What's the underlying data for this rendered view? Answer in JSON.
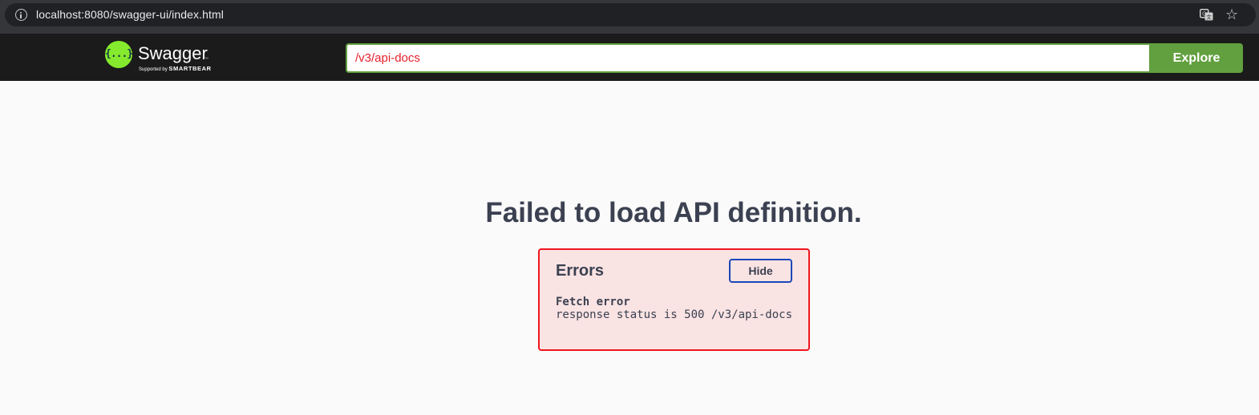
{
  "browser": {
    "url": "localhost:8080/swagger-ui/index.html",
    "icons": {
      "site_info": "info-circle-icon",
      "translate": "translate-icon",
      "bookmark": "star-icon"
    }
  },
  "topbar": {
    "logo": {
      "mark": "{...}",
      "name": "Swagger",
      "tm": "™",
      "supported_by": "Supported by",
      "brand": "SMARTBEAR"
    },
    "url_input_value": "/v3/api-docs",
    "explore_label": "Explore"
  },
  "main": {
    "title": "Failed to load API definition.",
    "errors": {
      "title": "Errors",
      "hide_label": "Hide",
      "error_heading": "Fetch error",
      "error_message": "response status is 500 /v3/api-docs"
    }
  },
  "colors": {
    "topbar_bg": "#1b1b1b",
    "accent_green": "#62a03f",
    "logo_green": "#85ea2d",
    "error_border": "#f0141e",
    "error_bg": "#fae3e3",
    "text": "#3b4151",
    "url_text": "#e8202a",
    "hide_border": "#1a47b8"
  }
}
